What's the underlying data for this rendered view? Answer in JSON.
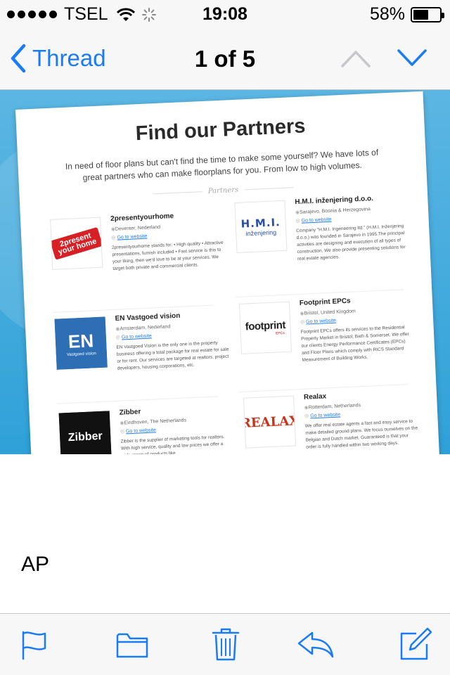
{
  "status_bar": {
    "carrier": "TSEL",
    "time": "19:08",
    "battery": "58%",
    "battery_level": 0.58
  },
  "nav": {
    "back_label": "Thread",
    "title": "1 of 5",
    "icons": [
      "chevron-left-icon",
      "chevron-up-icon",
      "chevron-down-icon"
    ]
  },
  "attachment": {
    "title": "Find our Partners",
    "intro": "In need of floor plans but can't find the time to make some yourself? We have lots of great partners who can make floorplans for you. From low to high volumes.",
    "section": "Partners",
    "partners": [
      {
        "name": "2presentyourhome",
        "location": "Deventer, Nederland",
        "link": "Go to website",
        "logo_text": "2present your home",
        "desc": "2presentyourhome stands for: • High quality • Attractive presentations, furnish included • Fast service Is this to your liking, then we'd love to be at your services. We target both private and commercial clients."
      },
      {
        "name": "H.M.I. inženjering d.o.o.",
        "location": "Sarajevo, Bosnia & Herzegovina",
        "link": "Go to website",
        "logo_text": "H.M.I.",
        "logo_sub": "inženjering",
        "desc": "Company \"H.M.I. Ingeneering ltd.\" (H.M.I. Inženjering d.o.o.) was founded in Sarajevo in 1995.The principal activities are designing and execution of all types of construction. We also provide presenting solutions for real estate agencies."
      },
      {
        "name": "EN Vastgoed vision",
        "location": "Amsterdam, Nederland",
        "link": "Go to website",
        "logo_text": "EN",
        "logo_sub": "Vastgoed vision",
        "desc": "EN Vastgoed Vision is the only one in the property business offering a total package for real estate for sale or for rent. Our services are targeted at realtors, project developers, housing corporations, etc."
      },
      {
        "name": "Footprint EPCs",
        "location": "Bristol, United Kingdom",
        "link": "Go to website",
        "logo_text": "footprint",
        "logo_sub": "EPCs",
        "desc": "Footprint EPCs offers its services to the Residential Property Market in Bristol, Bath & Somerset. We offer our clients Energy Performance Certificates (EPCs) and Floor Plans which comply with RICS Standard Measurement of Building Works."
      },
      {
        "name": "Zibber",
        "location": "Eindhoven, The Netherlands",
        "link": "Go to website",
        "logo_text": "Zibber",
        "desc": "Zibber is the supplier of marketing tools for realtors. With high service, quality and low prices we offer a wide range of products like"
      },
      {
        "name": "Realax",
        "location": "Rotterdam, Netherlands",
        "link": "Go to website",
        "logo_text": "REALAX",
        "desc": "We offer real estate agents a fast and easy service to make detailed ground plans. We focus ourselves on the Belgian and Dutch market. Guaranteed is that your order is fully handled within two working days."
      }
    ]
  },
  "message": {
    "text": "AP"
  },
  "toolbar": {
    "icons": [
      "flag-icon",
      "folder-icon",
      "trash-icon",
      "reply-icon",
      "compose-icon"
    ]
  },
  "colors": {
    "accent": "#1a7cf5",
    "bar_bg": "#f7f7f8",
    "attachment_bg": "#2fa1d8"
  }
}
